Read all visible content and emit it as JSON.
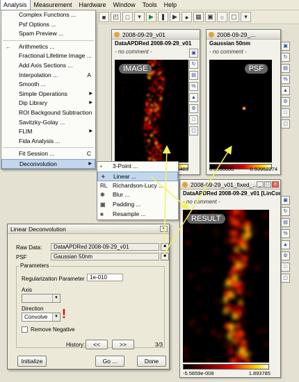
{
  "menubar": {
    "items": [
      "Analysis",
      "Measurement",
      "Hardware",
      "Window",
      "Tools",
      "Help"
    ]
  },
  "analysis_menu": {
    "items": [
      {
        "label": "Complex Functions ...",
        "arrow": false,
        "shortcut": "",
        "sep_after": false
      },
      {
        "label": "Psf Options ...",
        "arrow": false,
        "shortcut": "",
        "sep_after": false
      },
      {
        "label": "Spam Preview ...",
        "arrow": false,
        "shortcut": "",
        "sep_after": true
      },
      {
        "label": "Arithmetics ...",
        "arrow": false,
        "shortcut": "",
        "sep_after": false,
        "left_icon": "←"
      },
      {
        "label": "Fractional Lifetime Image ...",
        "arrow": false,
        "shortcut": "",
        "sep_after": false
      },
      {
        "label": "Add Axis Sections ...",
        "arrow": false,
        "shortcut": "",
        "sep_after": false
      },
      {
        "label": "Interpolation ...",
        "arrow": false,
        "shortcut": "A",
        "sep_after": false
      },
      {
        "label": "Smooth ...",
        "arrow": false,
        "shortcut": "",
        "sep_after": false
      },
      {
        "label": "Simple Operations",
        "arrow": true,
        "shortcut": "",
        "sep_after": false
      },
      {
        "label": "Dip Library",
        "arrow": true,
        "shortcut": "",
        "sep_after": false
      },
      {
        "label": "ROI Backgound Subtraction",
        "arrow": false,
        "shortcut": "",
        "sep_after": false
      },
      {
        "label": "Savitzky-Golay ...",
        "arrow": false,
        "shortcut": "",
        "sep_after": false
      },
      {
        "label": "FLIM",
        "arrow": true,
        "shortcut": "",
        "sep_after": false
      },
      {
        "label": "Fida Analysis ...",
        "arrow": false,
        "shortcut": "",
        "sep_after": true
      },
      {
        "label": "Fit Session ...",
        "arrow": false,
        "shortcut": "C",
        "sep_after": false
      },
      {
        "label": "Deconvolution",
        "arrow": true,
        "shortcut": "",
        "sep_after": false,
        "selected": true
      }
    ]
  },
  "deconv_menu": {
    "items": [
      {
        "label": "3-Point ...",
        "icon": "▪"
      },
      {
        "label": "Linear ...",
        "icon": "✦",
        "selected": true
      },
      {
        "label": "Richardson-Lucy ...",
        "icon": "RL"
      },
      {
        "label": "Blur ...",
        "icon": "✱"
      },
      {
        "label": "Padding ...",
        "icon": "▣"
      },
      {
        "label": "Resample ...",
        "icon": "■"
      }
    ]
  },
  "windows": {
    "image": {
      "title": "2008-09-29_v01",
      "name": "DataAPDRed 2008-09-29_v01",
      "comment": "- no comment -",
      "label": "IMAGE",
      "max": "34.46485"
    },
    "psf": {
      "title": "2008-09-29_...",
      "name": "Gaussian 50nm",
      "comment": "- no comment -",
      "label": "PSF",
      "min": "0.0000000",
      "max": "0.93952274"
    },
    "result": {
      "title": "2008-09-29_v01_fixed_...",
      "name": "DataAPDRed 2008-09-29_v01 [LinConv]",
      "comment": "- no comment -",
      "label": "RESULT",
      "min": "-5.5859e-008",
      "max": "1.893785"
    }
  },
  "dialog": {
    "title": "Linear Deconvolution",
    "raw_data_label": "Raw Data:",
    "raw_data_value": "DataAPDRed 2008-09-29_v01",
    "psf_label": "PSF",
    "psf_value": "Gaussian 50nm",
    "parameters_label": "Parameters",
    "reg_param_label": "Regularization Parameter",
    "reg_param_value": "1e-010",
    "axis_label": "Axis",
    "direction_label": "Direction",
    "direction_value": "Convolve",
    "remove_negative_label": "Remove Negative",
    "history_label": "History:",
    "history_back": "<<",
    "history_fwd": ">>",
    "history_count": "3/3",
    "initialize_label": "Initialize",
    "go_label": "Go ...",
    "done_label": "Done"
  },
  "colors": {
    "accent_arrow": "#f3f35a",
    "warning": "#e00000"
  }
}
